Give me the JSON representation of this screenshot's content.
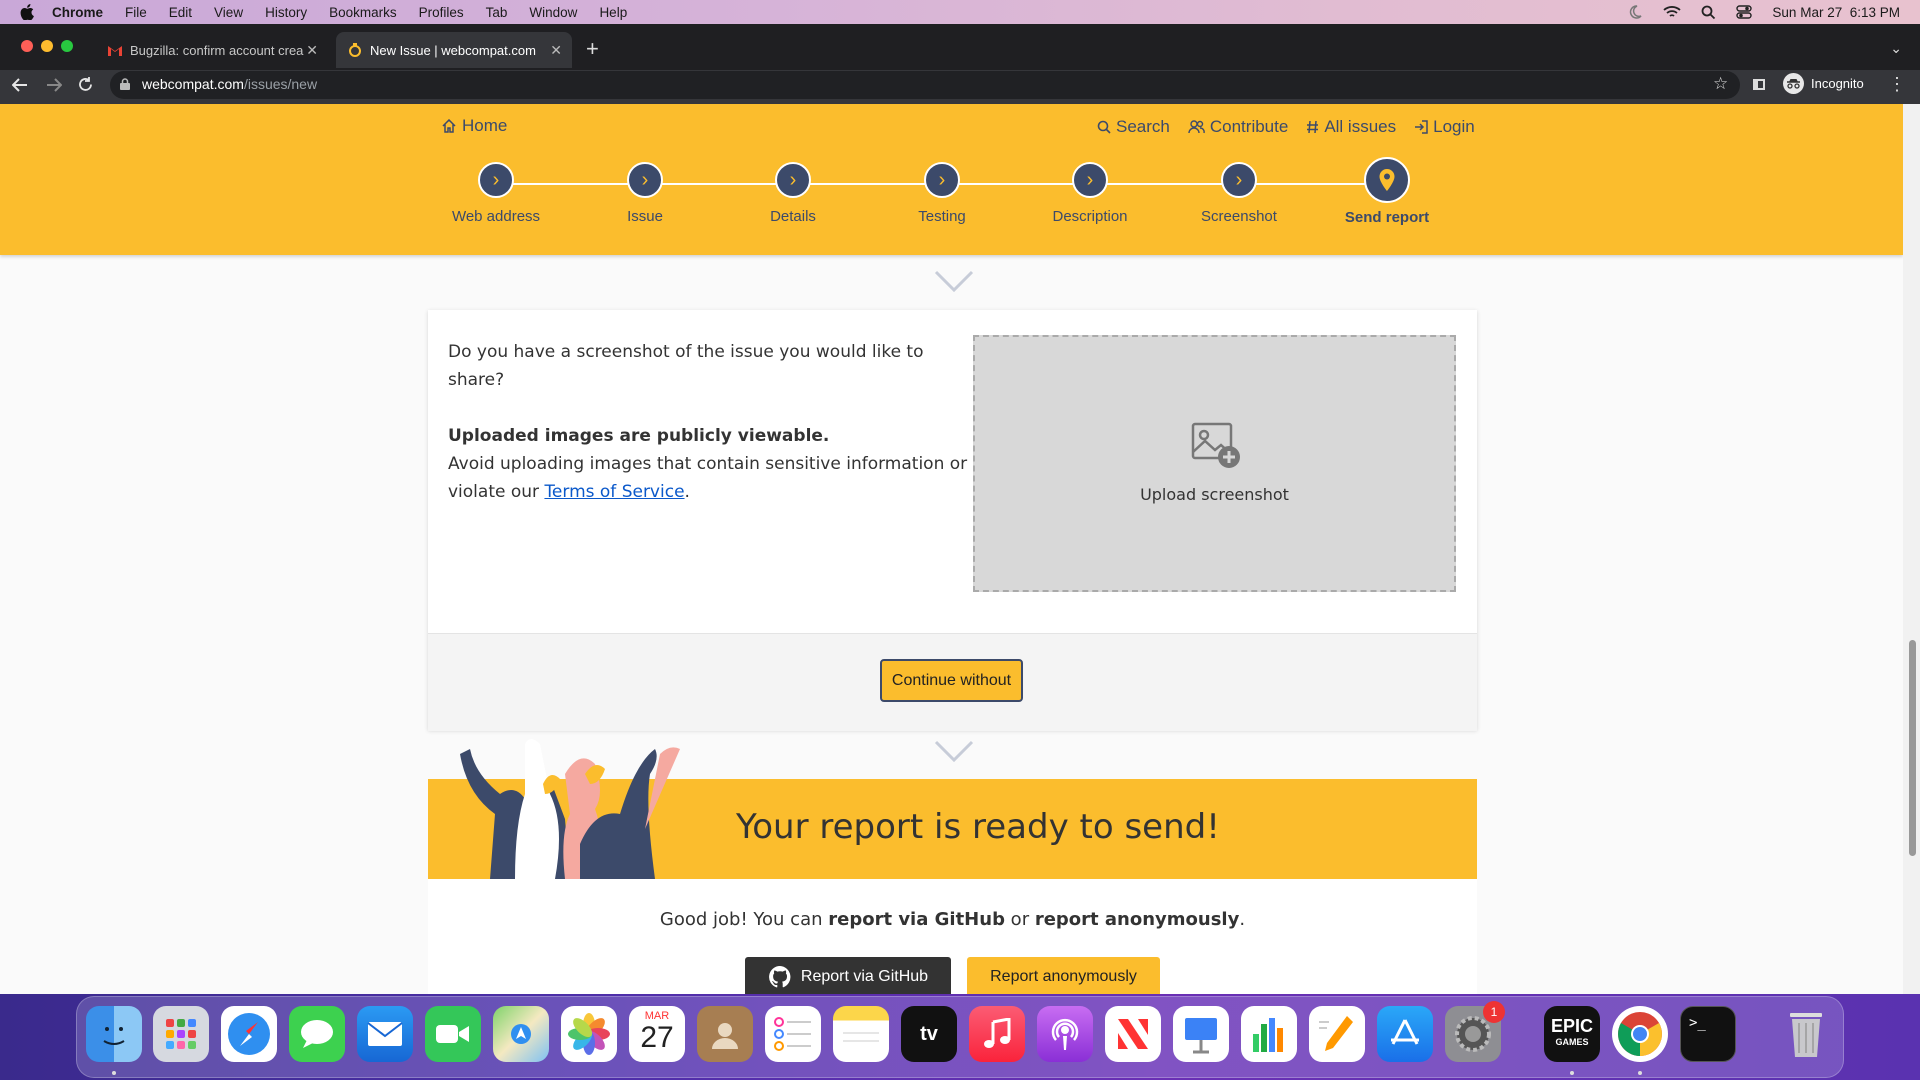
{
  "menubar": {
    "app": "Chrome",
    "items": [
      "File",
      "Edit",
      "View",
      "History",
      "Bookmarks",
      "Profiles",
      "Tab",
      "Window",
      "Help"
    ],
    "datetime": "Sun Mar 27  6:13 PM"
  },
  "browser": {
    "tabs": [
      {
        "title": "Bugzilla: confirm account crea"
      },
      {
        "title": "New Issue | webcompat.com"
      }
    ],
    "url_host": "webcompat.com",
    "url_path": "/issues/new",
    "profile_label": "Incognito"
  },
  "site": {
    "home_label": "Home",
    "nav": [
      {
        "label": "Search",
        "icon": "search-icon"
      },
      {
        "label": "Contribute",
        "icon": "people-icon"
      },
      {
        "label": "All issues",
        "icon": "hash-icon"
      },
      {
        "label": "Login",
        "icon": "login-icon"
      }
    ],
    "steps": [
      "Web address",
      "Issue",
      "Details",
      "Testing",
      "Description",
      "Screenshot",
      "Send report"
    ],
    "current_step": "Send report"
  },
  "screenshot_card": {
    "question": "Do you have a screenshot of the issue you would like to share?",
    "warning_bold": "Uploaded images are publicly viewable.",
    "warning_text": "Avoid uploading images that contain sensitive information or violate our",
    "tos_link": "Terms of Service",
    "tos_period": ".",
    "upload_label": "Upload screenshot",
    "continue_label": "Continue without"
  },
  "ready": {
    "title": "Your report is ready to send!",
    "text_prefix": "Good job! You can ",
    "text_github": "report via GitHub",
    "text_or": " or ",
    "text_anon": "report anonymously",
    "text_end": ".",
    "github_button": "Report via GitHub",
    "anon_button": "Report anonymously"
  },
  "dock": {
    "calendar_month": "MAR",
    "calendar_day": "27",
    "settings_badge": "1",
    "epic_line1": "EPIC",
    "epic_line2": "GAMES"
  },
  "colors": {
    "accent": "#fbbd2d",
    "navy": "#3c4a6a"
  }
}
